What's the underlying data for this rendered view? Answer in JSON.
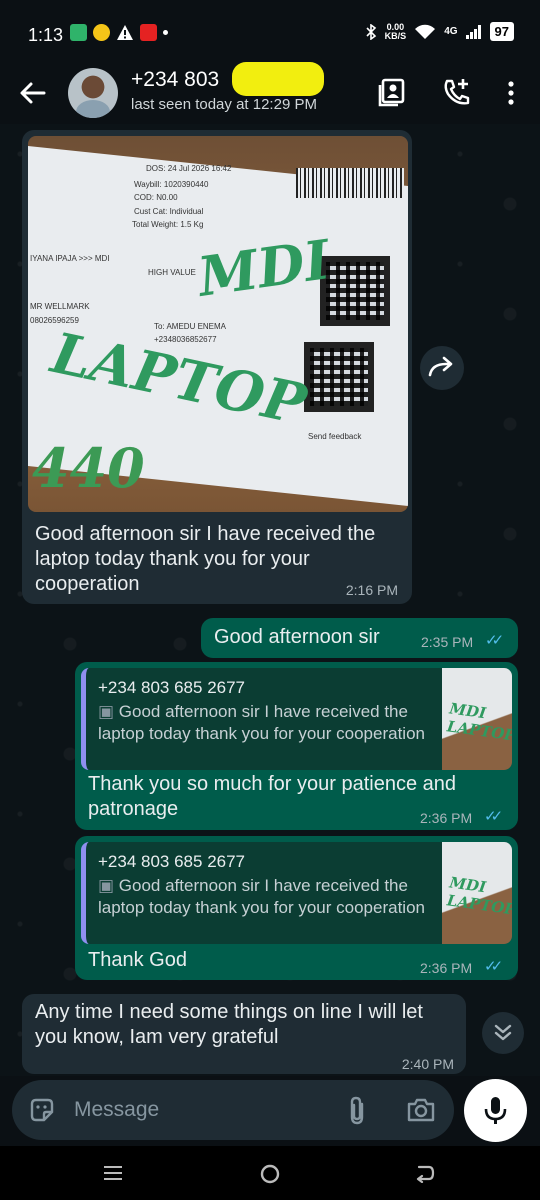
{
  "status_bar": {
    "time": "1:13",
    "network_speed_value": "0.00",
    "network_speed_unit": "KB/S",
    "network_type": "4G",
    "battery": "97"
  },
  "header": {
    "contact_name": "+234 803",
    "last_seen": "last seen today at 12:29 PM"
  },
  "messages": [
    {
      "direction": "incoming",
      "has_image": true,
      "image_text": {
        "date": "DOS: 24 Jul 2026 16:42",
        "waybill": "Waybill: 1020390440",
        "cod": "COD: N0.00",
        "cust_cat": "Cust Cat: Individual",
        "weight": "Total Weight: 1.5 Kg",
        "route": "IYANA IPAJA >>> MDI",
        "high_value": "HIGH VALUE",
        "sender": "MR WELLMARK",
        "sender_phone": "08026596259",
        "to": "To: AMEDU ENEMA",
        "to_phone": "+2348036852677",
        "feedback": "Send feedback",
        "hand_1": "MDI",
        "hand_2": "LAPTOP",
        "hand_3": "440"
      },
      "text": "Good afternoon sir I have received the laptop today thank you for your cooperation",
      "time": "2:16 PM"
    },
    {
      "direction": "outgoing",
      "text": "Good afternoon sir",
      "time": "2:35 PM"
    },
    {
      "direction": "outgoing",
      "quote_author": "+234 803 685 2677",
      "quote_text": "Good afternoon sir I have received the laptop today thank you for your cooperation",
      "quote_thumb_text": "MDI LAPTOP",
      "text": "Thank you so much for your patience and patronage",
      "time": "2:36 PM"
    },
    {
      "direction": "outgoing",
      "quote_author": "+234 803 685 2677",
      "quote_text": "Good afternoon sir I have received the laptop today thank you for your cooperation",
      "quote_thumb_text": "MDI LAPTOP",
      "text": "Thank God",
      "time": "2:36 PM"
    },
    {
      "direction": "incoming",
      "text": "Any time I need some things on line I will let you know, Iam very grateful",
      "time": "2:40 PM"
    }
  ],
  "input": {
    "placeholder": "Message"
  },
  "colors": {
    "background": "#0b1014",
    "incoming_bubble": "#1f2c34",
    "outgoing_bubble": "#005c4b",
    "read_ticks": "#53bdeb",
    "redaction": "#f2ee0f"
  },
  "icons": [
    "back-arrow-icon",
    "contacts-book-icon",
    "add-call-icon",
    "more-vert-icon",
    "forward-icon",
    "scroll-down-icon",
    "sticker-icon",
    "attach-icon",
    "camera-icon",
    "mic-icon"
  ]
}
